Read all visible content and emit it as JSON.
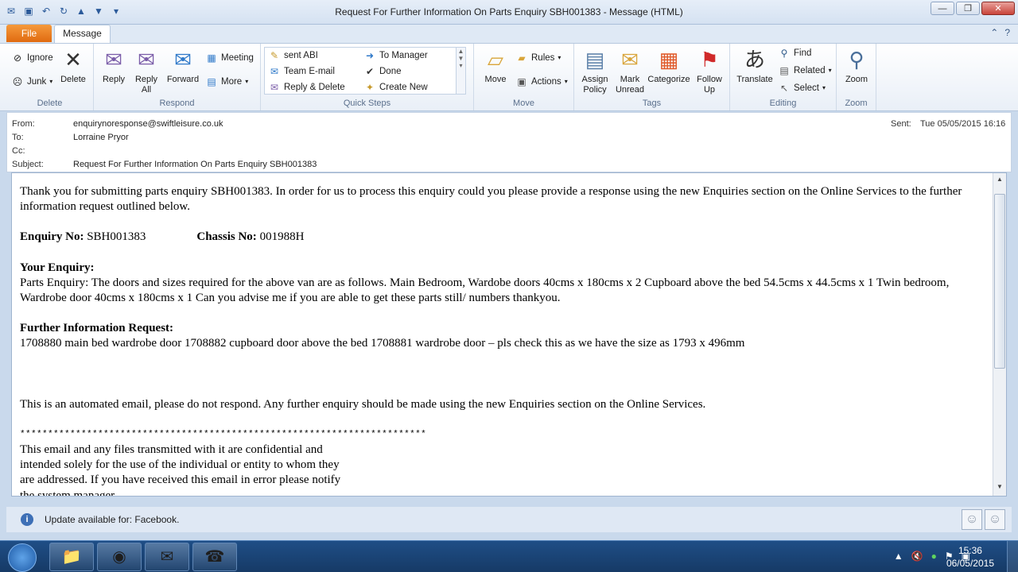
{
  "window": {
    "title": "Request For Further Information On Parts Enquiry SBH001383  -  Message (HTML)"
  },
  "tabs": {
    "file": "File",
    "message": "Message"
  },
  "ribbon": {
    "delete_group": {
      "label": "Delete",
      "ignore": "Ignore",
      "junk": "Junk",
      "delete": "Delete"
    },
    "respond_group": {
      "label": "Respond",
      "reply": "Reply",
      "reply_all_1": "Reply",
      "reply_all_2": "All",
      "forward": "Forward",
      "meeting": "Meeting",
      "more": "More"
    },
    "quicksteps_group": {
      "label": "Quick Steps",
      "items": [
        "sent ABI",
        "To Manager",
        "Team E-mail",
        "Done",
        "Reply & Delete",
        "Create New"
      ]
    },
    "move_group": {
      "label": "Move",
      "move": "Move",
      "rules": "Rules",
      "actions": "Actions"
    },
    "tags_group": {
      "label": "Tags",
      "assign_1": "Assign",
      "assign_2": "Policy",
      "mark_1": "Mark",
      "mark_2": "Unread",
      "categorize": "Categorize",
      "follow_1": "Follow",
      "follow_2": "Up"
    },
    "editing_group": {
      "label": "Editing",
      "translate": "Translate",
      "find": "Find",
      "related": "Related",
      "select": "Select"
    },
    "zoom_group": {
      "label": "Zoom",
      "zoom": "Zoom"
    }
  },
  "header": {
    "from_label": "From:",
    "from": "enquirynoresponse@swiftleisure.co.uk",
    "to_label": "To:",
    "to": "Lorraine Pryor",
    "cc_label": "Cc:",
    "subject_label": "Subject:",
    "subject": "Request For Further Information On Parts Enquiry SBH001383",
    "sent_label": "Sent:",
    "sent": "Tue 05/05/2015 16:16"
  },
  "body": {
    "intro": "Thank you for submitting parts enquiry SBH001383. In order for us to process this enquiry could you please provide a response using the new Enquiries section on the Online Services to the further information request outlined below.",
    "enquiry_label": "Enquiry No:",
    "enquiry_value": " SBH001383",
    "chassis_label": "Chassis No:",
    "chassis_value": " 001988H",
    "your_enquiry_heading": "Your Enquiry:",
    "your_enquiry_text": "Parts Enquiry: The doors and sizes required for the above van are as follows. Main Bedroom, Wardobe doors 40cms x 180cms x 2 Cupboard above the bed 54.5cms x 44.5cms x 1 Twin bedroom, Wardrobe door 40cms x 180cms x 1 Can you advise me if you are able to get these parts still/ numbers thankyou.",
    "further_heading": "Further Information Request:",
    "further_text": "1708880 main bed wardrobe door 1708882 cupboard door above the bed 1708881 wardrobe door – pls check this as we have the size as 1793 x 496mm",
    "automated": "This is an automated email, please do not respond. Any further enquiry should be made using the new Enquiries section on the Online Services.",
    "stars": "*************************************************************************",
    "disclaimer_1": "This email and any files transmitted with it are confidential and",
    "disclaimer_2": "intended solely for the use of the individual or entity to whom they",
    "disclaimer_3": "are addressed. If you have received this email in error please notify",
    "disclaimer_4": "the system manager."
  },
  "infobar": {
    "text": "Update available for: Facebook."
  },
  "taskbar": {
    "time": "15:36",
    "date": "06/05/2015"
  }
}
